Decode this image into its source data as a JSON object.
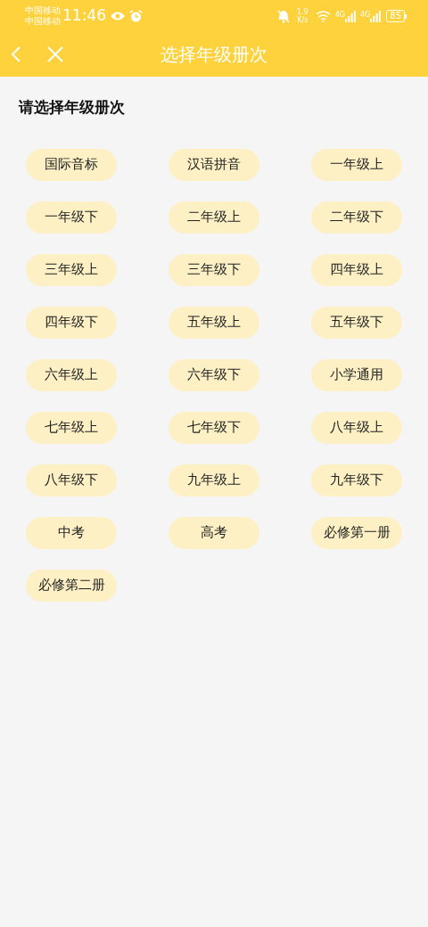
{
  "status_bar": {
    "carriers": [
      "中国移动",
      "中国移动"
    ],
    "time": "11:46",
    "speed_value": "1.9",
    "speed_unit": "K/s",
    "network_labels": [
      "4G",
      "4G"
    ],
    "battery": "85"
  },
  "nav": {
    "title": "选择年级册次"
  },
  "section": {
    "heading": "请选择年级册次"
  },
  "grades": [
    {
      "label": "国际音标"
    },
    {
      "label": "汉语拼音"
    },
    {
      "label": "一年级上"
    },
    {
      "label": "一年级下"
    },
    {
      "label": "二年级上"
    },
    {
      "label": "二年级下"
    },
    {
      "label": "三年级上"
    },
    {
      "label": "三年级下"
    },
    {
      "label": "四年级上"
    },
    {
      "label": "四年级下"
    },
    {
      "label": "五年级上"
    },
    {
      "label": "五年级下"
    },
    {
      "label": "六年级上"
    },
    {
      "label": "六年级下"
    },
    {
      "label": "小学通用"
    },
    {
      "label": "七年级上"
    },
    {
      "label": "七年级下"
    },
    {
      "label": "八年级上"
    },
    {
      "label": "八年级下"
    },
    {
      "label": "九年级上"
    },
    {
      "label": "九年级下"
    },
    {
      "label": "中考"
    },
    {
      "label": "高考"
    },
    {
      "label": "必修第一册"
    },
    {
      "label": "必修第二册"
    }
  ]
}
